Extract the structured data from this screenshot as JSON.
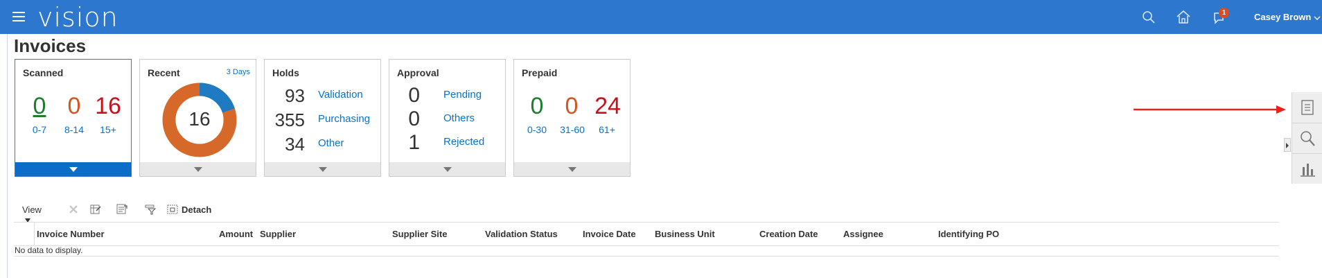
{
  "app": {
    "logo": "vision",
    "user": "Casey Brown",
    "notification_count": "1",
    "brand_color": "#2e77cf"
  },
  "page": {
    "title": "Invoices"
  },
  "cards": {
    "scanned": {
      "title": "Scanned",
      "values": [
        "0",
        "0",
        "16"
      ],
      "labels": [
        "0-7",
        "8-14",
        "15+"
      ]
    },
    "recent": {
      "title": "Recent",
      "extra": "3 Days",
      "center": "16",
      "donut_fraction_blue": 0.2
    },
    "holds": {
      "title": "Holds",
      "rows": [
        {
          "num": "93",
          "label": "Validation"
        },
        {
          "num": "355",
          "label": "Purchasing"
        },
        {
          "num": "34",
          "label": "Other"
        }
      ]
    },
    "approval": {
      "title": "Approval",
      "rows": [
        {
          "num": "0",
          "label": "Pending"
        },
        {
          "num": "0",
          "label": "Others"
        },
        {
          "num": "1",
          "label": "Rejected"
        }
      ]
    },
    "prepaid": {
      "title": "Prepaid",
      "values": [
        "0",
        "0",
        "24"
      ],
      "labels": [
        "0-30",
        "31-60",
        "61+"
      ]
    }
  },
  "toolbar": {
    "view": "View",
    "detach": "Detach"
  },
  "table": {
    "columns": [
      "Invoice Number",
      "Amount",
      "Supplier",
      "Supplier Site",
      "Validation Status",
      "Invoice Date",
      "Business Unit",
      "Creation Date",
      "Assignee",
      "Identifying PO"
    ],
    "empty": "No data to display."
  },
  "icons": {
    "menu": "hamburger-icon",
    "search": "search-icon",
    "home": "home-icon",
    "notifications": "bell-icon",
    "panel": [
      "document-icon",
      "magnifier-icon",
      "bar-chart-icon"
    ]
  }
}
